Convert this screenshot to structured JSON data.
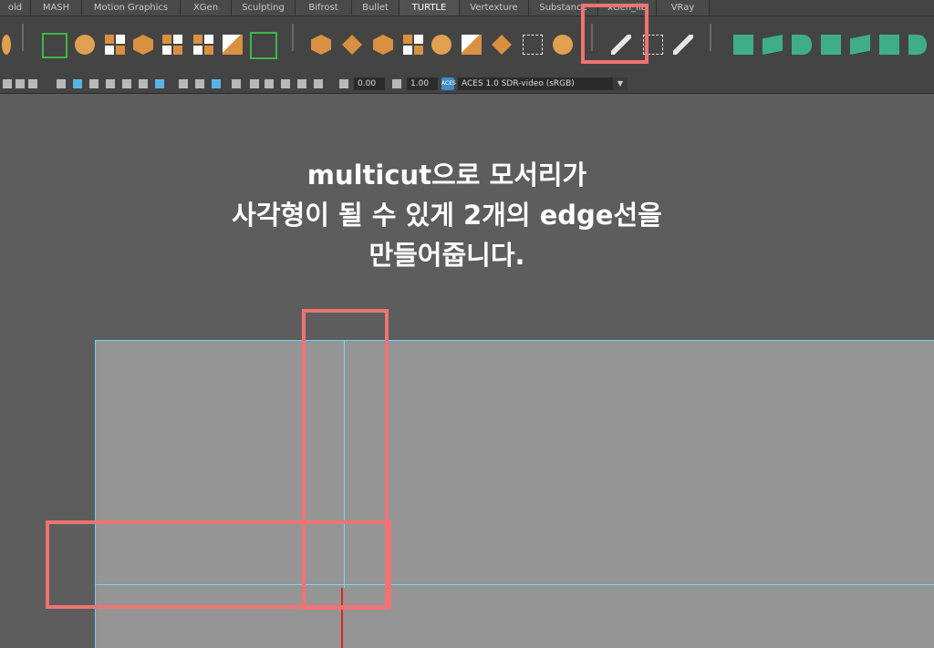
{
  "shelf_tabs": [
    {
      "label": "old",
      "active": false
    },
    {
      "label": "MASH",
      "active": false
    },
    {
      "label": "Motion Graphics",
      "active": false
    },
    {
      "label": "XGen",
      "active": false
    },
    {
      "label": "Sculpting",
      "active": false
    },
    {
      "label": "Bifrost",
      "active": false
    },
    {
      "label": "Bullet",
      "active": false
    },
    {
      "label": "TURTLE",
      "active": true
    },
    {
      "label": "Vertexture",
      "active": false
    },
    {
      "label": "Substance",
      "active": false
    },
    {
      "label": "xGen_lib",
      "active": false
    },
    {
      "label": "VRay",
      "active": false
    }
  ],
  "shelf": {
    "icons": [
      "maya-shelf-icon",
      "poly-sphere-bracket-icon",
      "orange-shape-icon",
      "split-icon",
      "combine-icon",
      "checker-icon",
      "grid-icon",
      "refresh-bracket-icon",
      "cube-extrude-icon",
      "bridge-icon",
      "cube-icon",
      "smooth-icon",
      "circle-mesh-icon",
      "bevel-icon",
      "flatten-icon",
      "bounds-icon",
      "target-icon",
      "multicut-tool-icon",
      "select-box-icon",
      "select-brush-icon",
      "green-shape-icon",
      "green-mask-icon",
      "green-hex-icon",
      "green-cube-icon",
      "green-arrow-icon",
      "green-checker-icon",
      "green-network-icon"
    ],
    "highlighted_tool": "multicut-tool-icon"
  },
  "panel_toolbar": {
    "exposure_value": "0.00",
    "gamma_value": "1.00",
    "colorspace_badge": "ACES",
    "colorspace_label": "ACES 1.0 SDR-video (sRGB)"
  },
  "caption": {
    "line1": "multicut으로 모서리가",
    "line2": "사각형이 될 수 있게 2개의 edge선을",
    "line3": "만들어줍니다."
  },
  "colors": {
    "highlight": "#f07373",
    "edge": "#7bd6f2",
    "mesh": "#959595",
    "viewport_bg": "#5d5d5d",
    "cut_line": "#e0231e"
  }
}
